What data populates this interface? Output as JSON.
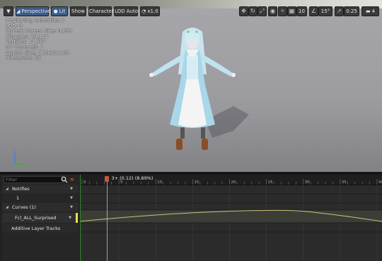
{
  "toolbar": {
    "menu_icon": "dropdown-triangle-icon",
    "perspective_label": "Perspective",
    "lit_label": "Lit",
    "show_label": "Show",
    "character_label": "Character",
    "lod_label": "LOD Auto",
    "speed_label": "x1.0",
    "grid_snap_value": "10",
    "angle_snap_value": "15°",
    "scale_snap_value": "0.25",
    "camera_speed_value": "4"
  },
  "stats": {
    "previewing": "Previewing Animation B",
    "lod": "LOD: 0",
    "screen_size": "Current Screen Size: 0.899",
    "triangles": "Triangles: 29,164",
    "vertices": "Vertices: 14,384",
    "uv_channels": "UV Channels: 1",
    "approx_size": "Approx Size: 112x29x165",
    "framerate": "Framerate: 30"
  },
  "sequencer": {
    "filter_placeholder": "Filter",
    "notifies_label": "Notifies",
    "notify_track_number": "1",
    "curves_label": "Curves  (1)",
    "curve_name": "Fcl_ALL_Surprised",
    "additive_label": "Additive Layer Tracks",
    "frame_readout": "3+ (0.12) (8.89%)",
    "playhead_frame": 3.4,
    "total_frames": 40,
    "ruler_ticks": [
      {
        "frame": 0,
        "label": "0"
      },
      {
        "frame": 5,
        "label": "5"
      },
      {
        "frame": 10,
        "label": "10"
      },
      {
        "frame": 15,
        "label": "15"
      },
      {
        "frame": 20,
        "label": "20"
      },
      {
        "frame": 25,
        "label": "25"
      },
      {
        "frame": 30,
        "label": "30"
      },
      {
        "frame": 35,
        "label": "35"
      },
      {
        "frame": 40,
        "label": "40"
      }
    ]
  },
  "colors": {
    "playhead": "#c55a3b",
    "curve": "#c9c47a",
    "curve_marker": "#e7e34a",
    "start_line": "#2d8a2d"
  }
}
